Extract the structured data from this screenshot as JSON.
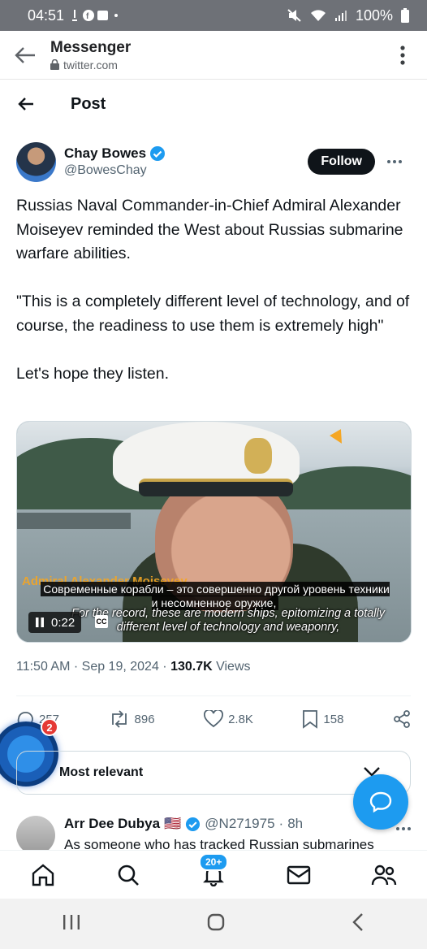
{
  "status_bar": {
    "time": "04:51",
    "battery": "100%"
  },
  "browser": {
    "title": "Messenger",
    "url": "twitter.com"
  },
  "header": {
    "title": "Post"
  },
  "author": {
    "name": "Chay Bowes",
    "handle": "@BowesChay",
    "follow_label": "Follow"
  },
  "tweet": {
    "text": "Russias Naval Commander-in-Chief Admiral Alexander Moiseyev reminded the West about Russias submarine warfare abilities.\n\n\"This is a completely different level of technology, and of course, the readiness to use them is extremely high\"\n\nLet's hope they listen."
  },
  "video": {
    "time": "0:22",
    "cc_label": "CC",
    "lower_third": "Admiral Alexander Moiseyev",
    "subtitle_ru": "Современные корабли – это совершенно другой уровень техники и несомненное оружие,",
    "subtitle_en": "For the record, these are modern ships, epitomizing a totally different level of technology and weaponry,"
  },
  "meta": {
    "time": "11:50 AM",
    "date": "Sep 19, 2024",
    "views_count": "130.7K",
    "views_label": "Views"
  },
  "actions": {
    "replies": "257",
    "reposts": "896",
    "likes": "2.8K",
    "bookmarks": "158"
  },
  "ai_badge_count": "2",
  "sort": {
    "label": "Most relevant"
  },
  "reply": {
    "name": "Arr Dee Dubya",
    "flag": "🇺🇸",
    "handle": "@N271975",
    "age": "8h",
    "text": "As someone who has tracked Russian submarines"
  },
  "bottom_nav": {
    "notifications_badge": "20+"
  },
  "colors": {
    "accent": "#1d9bf0",
    "text": "#0f1419",
    "muted": "#536471",
    "orange": "#f5a623"
  }
}
